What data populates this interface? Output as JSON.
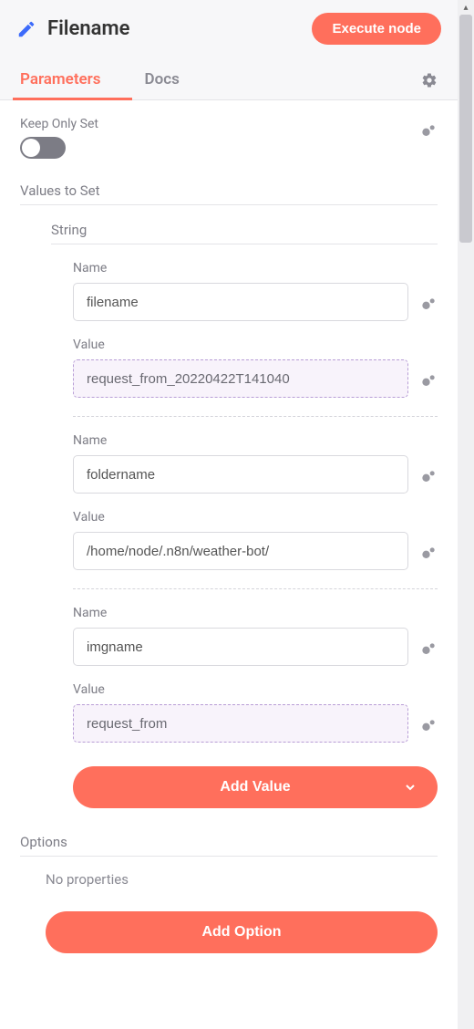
{
  "header": {
    "title": "Filename",
    "execute_label": "Execute node"
  },
  "tabs": {
    "parameters": "Parameters",
    "docs": "Docs"
  },
  "params": {
    "keep_only_set_label": "Keep Only Set",
    "values_to_set_label": "Values to Set",
    "string_label": "String",
    "name_label": "Name",
    "value_label": "Value",
    "entries": [
      {
        "name": "filename",
        "value": "request_from_20220422T141040",
        "expr": true
      },
      {
        "name": "foldername",
        "value": "/home/node/.n8n/weather-bot/",
        "expr": false
      },
      {
        "name": "imgname",
        "value": "request_from",
        "expr": true
      }
    ],
    "add_value_label": "Add Value",
    "options_label": "Options",
    "no_properties_label": "No properties",
    "add_option_label": "Add Option"
  }
}
